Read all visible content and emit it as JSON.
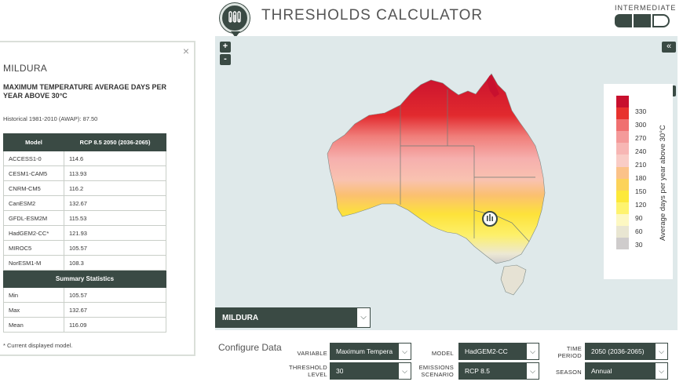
{
  "header": {
    "title": "THRESHOLDS CALCULATOR",
    "level_label": "INTERMEDIATE"
  },
  "panel": {
    "close": "×",
    "location": "MILDURA",
    "metric": "MAXIMUM TEMPERATURE AVERAGE DAYS PER YEAR ABOVE 30°C",
    "historical": "Historical 1981-2010 (AWAP): 87.50",
    "table": {
      "col_model": "Model",
      "col_value": "RCP 8.5 2050 (2036-2065)",
      "rows": [
        {
          "model": "ACCESS1-0",
          "value": "114.6"
        },
        {
          "model": "CESM1-CAM5",
          "value": "113.93"
        },
        {
          "model": "CNRM-CM5",
          "value": "116.2"
        },
        {
          "model": "CanESM2",
          "value": "132.67"
        },
        {
          "model": "GFDL-ESM2M",
          "value": "115.53"
        },
        {
          "model": "HadGEM2-CC*",
          "value": "121.93"
        },
        {
          "model": "MIROC5",
          "value": "105.57"
        },
        {
          "model": "NorESM1-M",
          "value": "108.3"
        }
      ],
      "summary_title": "Summary Statistics",
      "summary": [
        {
          "label": "Min",
          "value": "105.57"
        },
        {
          "label": "Max",
          "value": "132.67"
        },
        {
          "label": "Mean",
          "value": "116.09"
        }
      ]
    },
    "note": "* Current displayed model."
  },
  "map": {
    "zoom_in": "+",
    "zoom_out": "-",
    "collapse": "«",
    "legend_collapse": "»",
    "legend": {
      "title": "Average days per year above 30°C",
      "ticks": [
        "330",
        "300",
        "270",
        "240",
        "210",
        "180",
        "150",
        "120",
        "90",
        "60",
        "30"
      ],
      "colors": [
        "#c8102e",
        "#e8322e",
        "#f07070",
        "#f49a9a",
        "#f7b6b4",
        "#f9ccc6",
        "#fbc289",
        "#fcd35a",
        "#fde93a",
        "#fef36f",
        "#fdf8c2",
        "#e9e6d2",
        "#cfcccc"
      ]
    },
    "location_select": "MILDURA"
  },
  "config": {
    "title": "Configure Data",
    "variable": {
      "label": "VARIABLE",
      "value": "Maximum Tempera"
    },
    "model": {
      "label": "MODEL",
      "value": "HadGEM2-CC"
    },
    "time_period": {
      "label_1": "TIME",
      "label_2": "PERIOD",
      "value": "2050 (2036-2065)"
    },
    "threshold": {
      "label_1": "THRESHOLD",
      "label_2": "LEVEL",
      "value": "30"
    },
    "scenario": {
      "label_1": "EMISSIONS",
      "label_2": "SCENARIO",
      "value": "RCP 8.5"
    },
    "season": {
      "label": "SEASON",
      "value": "Annual"
    },
    "arrow": "⌵"
  }
}
